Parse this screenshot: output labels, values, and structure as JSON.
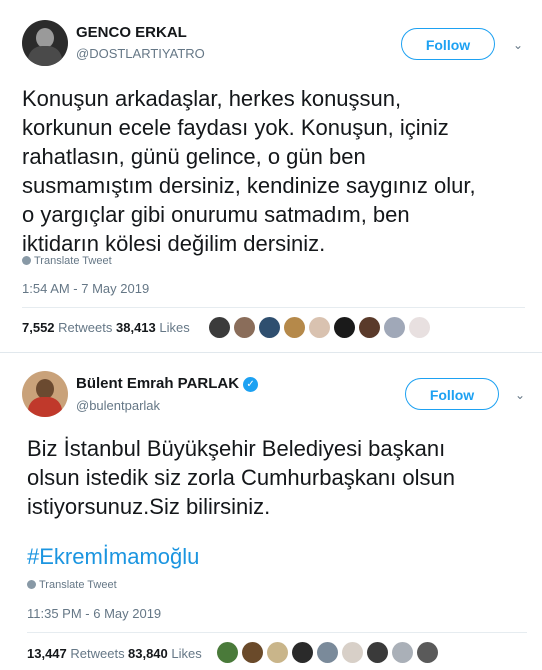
{
  "tweet1": {
    "name": "GENCO ERKAL",
    "handle": "@DOSTLARTIYATRO",
    "follow_label": "Follow",
    "text_lines": [
      "Konuşun arkadaşlar, herkes konuşsun,",
      "korkunun ecele faydası yok. Konuşun, içiniz",
      "rahatlasın, günü gelince, o gün ben",
      "susmamıştım dersiniz, kendinize saygınız olur,",
      "o yargıçlar gibi onurumu satmadım, ben",
      "iktidarın kölesi değilim dersiniz."
    ],
    "translate_label": "Translate Tweet",
    "timestamp": "1:54 AM - 7 May 2019",
    "retweets_count": "7,552",
    "retweets_label": "Retweets",
    "likes_count": "38,413",
    "likes_label": "Likes",
    "liker_colors": [
      "#3b3b3b",
      "#8a6d5a",
      "#2f4f6f",
      "#b5894a",
      "#d9c2b0",
      "#1a1a1a",
      "#5a3a2a",
      "#a0a8b8",
      "#e8e0e0"
    ]
  },
  "tweet2": {
    "name": "Bülent Emrah PARLAK",
    "handle": "@bulentparlak",
    "follow_label": "Follow",
    "text_lines": [
      "Biz İstanbul Büyükşehir Belediyesi başkanı",
      "olsun istedik siz zorla Cumhurbaşkanı olsun",
      "istiyorsunuz.Siz bilirsiniz."
    ],
    "hashtag": "#Ekremİmamoğlu",
    "translate_label": "Translate Tweet",
    "timestamp": "11:35 PM - 6 May 2019",
    "retweets_count": "13,447",
    "retweets_label": "Retweets",
    "likes_count": "83,840",
    "likes_label": "Likes",
    "liker_colors": [
      "#4a7a3a",
      "#6a4a2a",
      "#c9b58a",
      "#2a2a2a",
      "#7a8a9a",
      "#d8d0c8",
      "#3a3a3a",
      "#aab0b8",
      "#5a5a5a"
    ]
  }
}
